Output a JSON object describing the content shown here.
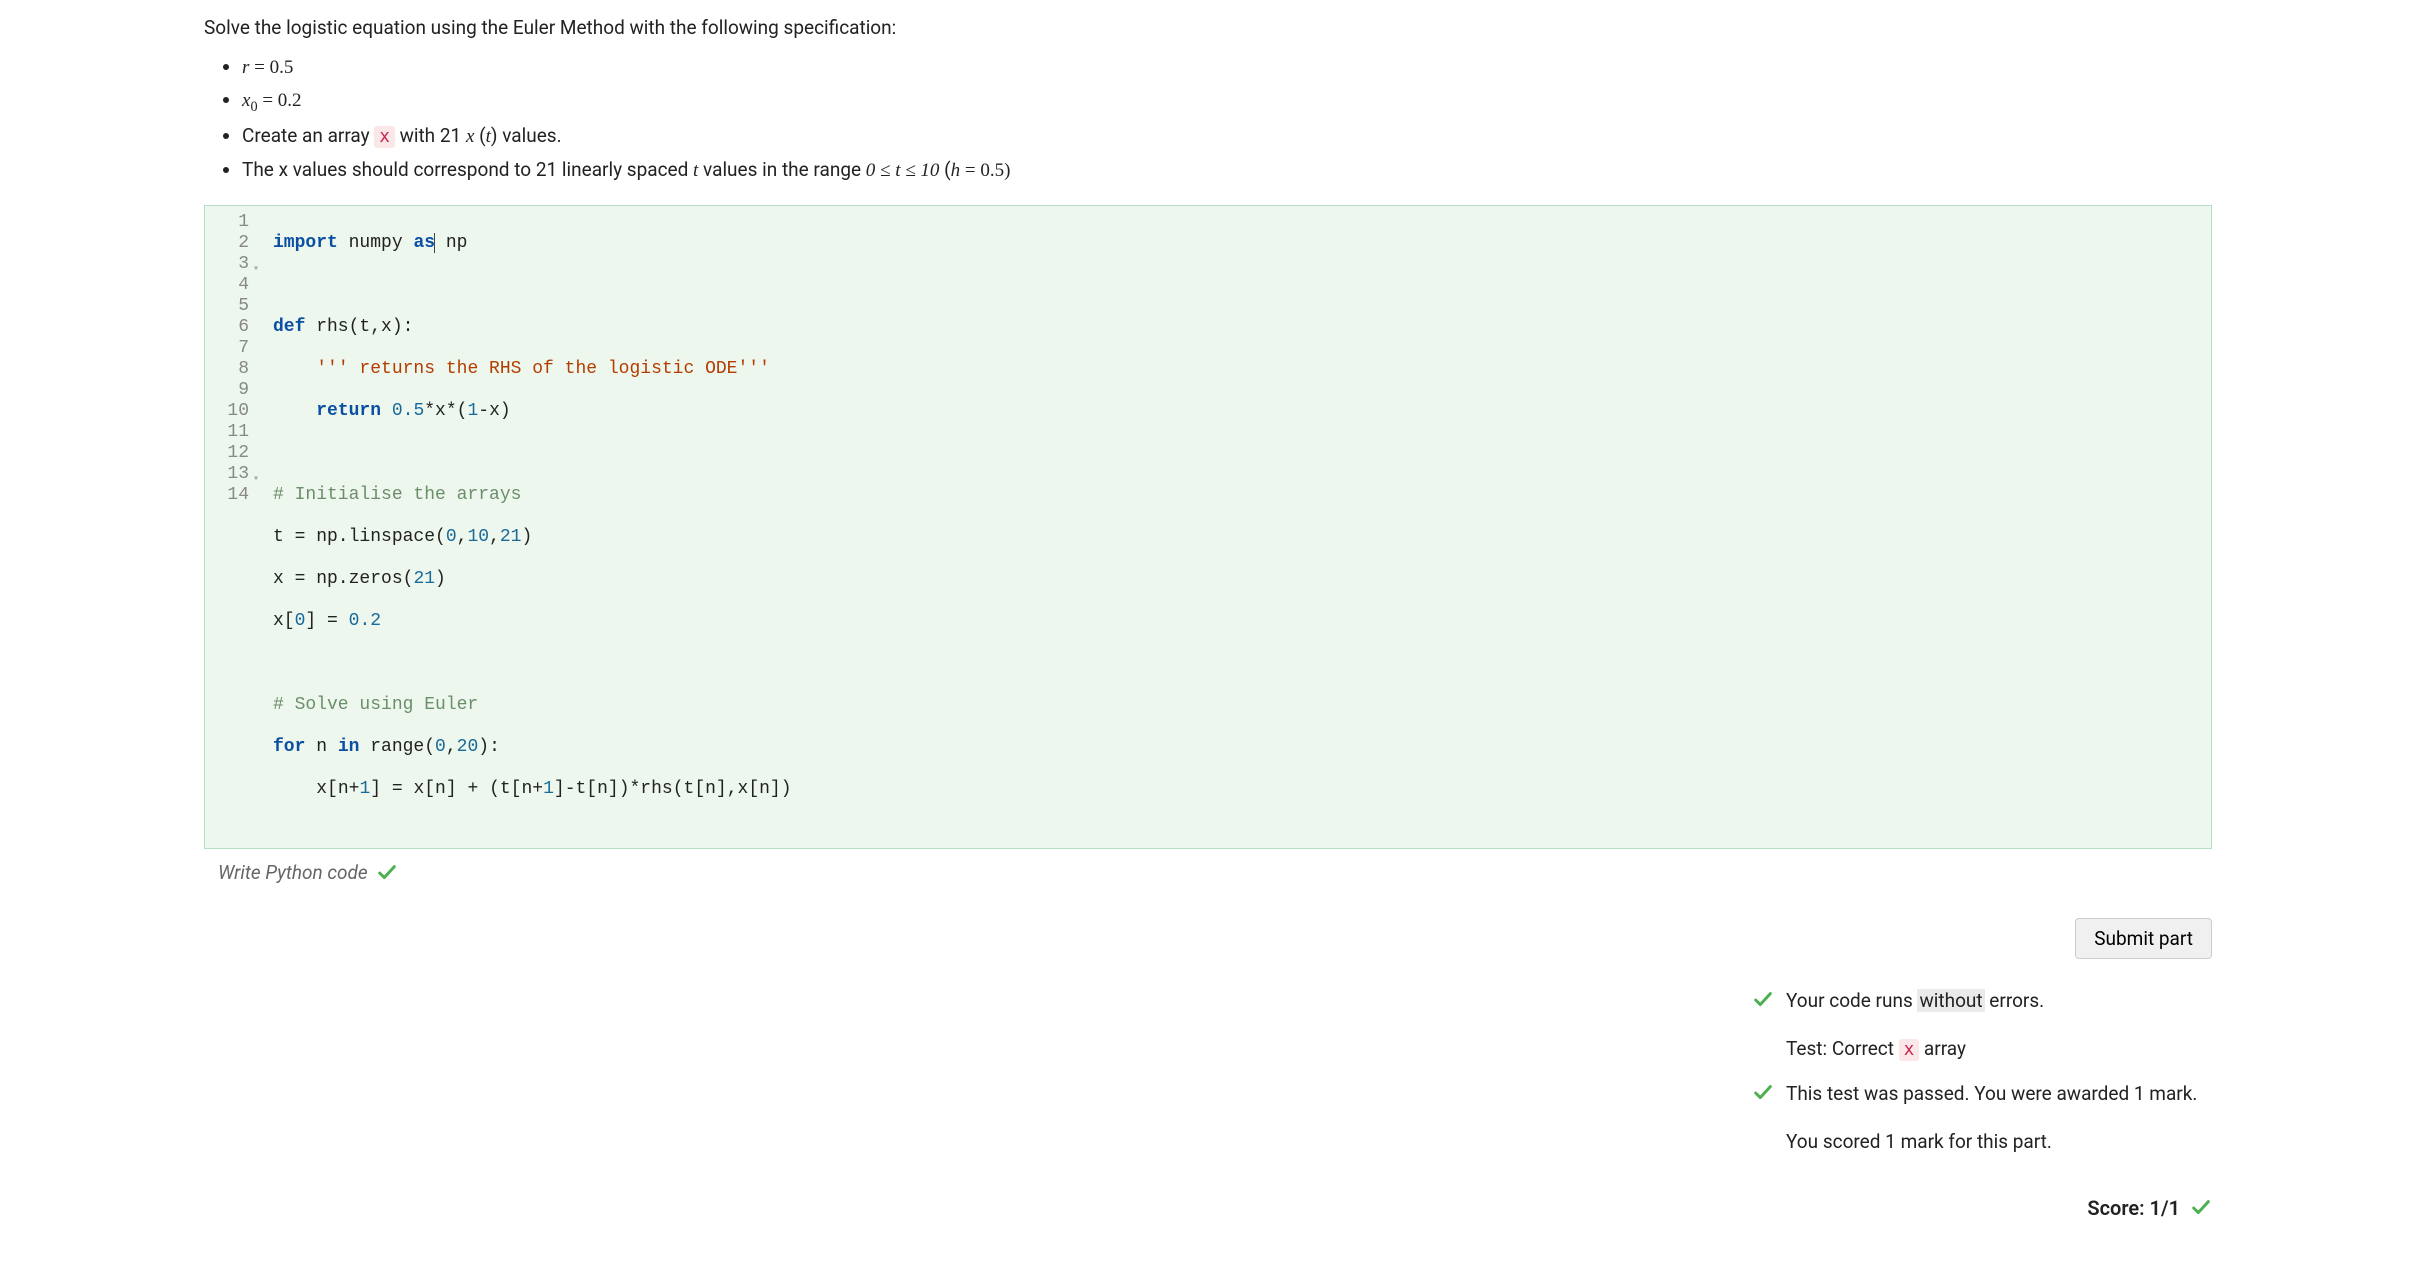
{
  "prompt": {
    "intro": "Solve the logistic equation using the Euler Method with the following specification:",
    "bullet1_var": "r",
    "bullet1_eq": " = 0.5",
    "bullet2_var": "x",
    "bullet2_sub": "0",
    "bullet2_eq": " = 0.2",
    "bullet3_a": "Create an array ",
    "bullet3_code": "x",
    "bullet3_b": " with 21 ",
    "bullet3_xt_x": "x",
    "bullet3_xt_open": " (",
    "bullet3_xt_t": "t",
    "bullet3_xt_close": ") values.",
    "bullet4_a": "The x values should correspond to 21 linearly spaced ",
    "bullet4_t": "t",
    "bullet4_b": " values in the range ",
    "bullet4_range": "0 ≤ t ≤ 10",
    "bullet4_c": " (",
    "bullet4_h": "h",
    "bullet4_d": " = 0.5)"
  },
  "editor": {
    "line_count": 14,
    "code": {
      "l1_import": "import",
      "l1_sp1": " numpy ",
      "l1_as": "as",
      "l1_np": " np",
      "l3_def": "def",
      "l3_rest": " rhs(t,x):",
      "l4_indent": "    ",
      "l4_doc": "''' returns the RHS of the logistic ODE'''",
      "l5_indent": "    ",
      "l5_return": "return",
      "l5_sp": " ",
      "l5_num1": "0.5",
      "l5_mid": "*x*(",
      "l5_num2": "1",
      "l5_end": "-x)",
      "l7_cmt": "# Initialise the arrays",
      "l8_a": "t = np.linspace(",
      "l8_n1": "0",
      "l8_c1": ",",
      "l8_n2": "10",
      "l8_c2": ",",
      "l8_n3": "21",
      "l8_b": ")",
      "l9_a": "x = np.zeros(",
      "l9_n": "21",
      "l9_b": ")",
      "l10_a": "x[",
      "l10_n1": "0",
      "l10_b": "] = ",
      "l10_n2": "0.2",
      "l12_cmt": "# Solve using Euler",
      "l13_for": "for",
      "l13_a": " n ",
      "l13_in": "in",
      "l13_b": " range(",
      "l13_n1": "0",
      "l13_c": ",",
      "l13_n2": "20",
      "l13_d": "):",
      "l14_indent": "    ",
      "l14_a": "x[n+",
      "l14_n1": "1",
      "l14_b": "] = x[n] + (t[n+",
      "l14_n2": "1",
      "l14_c": "]-t[n])*rhs(t[n],x[n])"
    }
  },
  "caption": "Write Python code",
  "submit_label": "Submit part",
  "feedback": {
    "runs_a": "Your code runs ",
    "runs_hl": "without",
    "runs_b": " errors.",
    "test_a": "Test: Correct ",
    "test_code": "x",
    "test_b": " array",
    "passed": "This test was passed. You were awarded 1 mark.",
    "scored": "You scored 1 mark for this part.",
    "score_label": "Score: 1/1"
  }
}
